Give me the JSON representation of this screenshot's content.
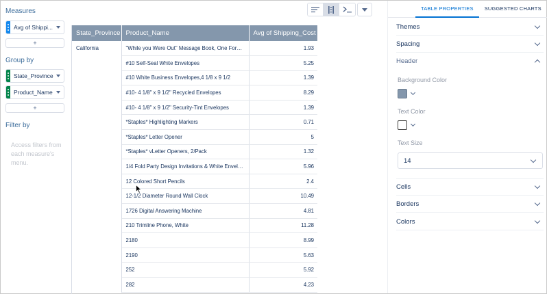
{
  "left_panel": {
    "measures_title": "Measures",
    "measure_pill": "Avg of Shippi...",
    "groupby_title": "Group by",
    "groups": [
      "State_Province",
      "Product_Name"
    ],
    "add_label": "+",
    "filter_title": "Filter by",
    "filter_hint": "Access filters from each measure's menu."
  },
  "toolbar": {
    "icons": [
      "align-lines-icon",
      "column-grid-icon",
      "console-icon"
    ],
    "active_index": 1,
    "dropdown_icon": "chevron-down-icon"
  },
  "table": {
    "headers": [
      "State_Province",
      "Product_Name",
      "Avg of Shipping_Cost"
    ],
    "state": "California",
    "rows": [
      {
        "product": "\"While you Were Out\" Message Book, One Form ...",
        "value": "1.93"
      },
      {
        "product": "#10 Self-Seal White Envelopes",
        "value": "5.25"
      },
      {
        "product": "#10 White Business Envelopes,4 1/8 x 9 1/2",
        "value": "1.39"
      },
      {
        "product": "#10- 4 1/8\" x 9 1/2\" Recycled Envelopes",
        "value": "8.29"
      },
      {
        "product": "#10- 4 1/8\" x 9 1/2\" Security-Tint Envelopes",
        "value": "1.39"
      },
      {
        "product": "*Staples* Highlighting Markers",
        "value": "0.71"
      },
      {
        "product": "*Staples* Letter Opener",
        "value": "5"
      },
      {
        "product": "*Staples* vLetter Openers, 2/Pack",
        "value": "1.32"
      },
      {
        "product": "1/4 Fold Party Design Invitations & White Envelo...",
        "value": "5.96"
      },
      {
        "product": "12 Colored Short Pencils",
        "value": "2.4"
      },
      {
        "product": "12-1/2 Diameter Round Wall Clock",
        "value": "10.49"
      },
      {
        "product": "1726 Digital Answering Machine",
        "value": "4.81"
      },
      {
        "product": "210 Trimline Phone, White",
        "value": "11.28"
      },
      {
        "product": "2180",
        "value": "8.99"
      },
      {
        "product": "2190",
        "value": "5.63"
      },
      {
        "product": "252",
        "value": "5.92"
      },
      {
        "product": "282",
        "value": "4.23"
      }
    ]
  },
  "right_panel": {
    "tabs": [
      "TABLE PROPERTIES",
      "SUGGESTED CHARTS"
    ],
    "active_tab": 0,
    "sections": {
      "themes": "Themes",
      "spacing": "Spacing",
      "header": "Header",
      "cells": "Cells",
      "borders": "Borders",
      "colors": "Colors"
    },
    "background_color_label": "Background Color",
    "background_color_value": "#8497ac",
    "text_color_label": "Text Color",
    "text_color_value": "#ffffff",
    "text_size_label": "Text Size",
    "text_size_value": "14"
  },
  "colors": {
    "accent": "#0070d2",
    "header_bg": "#8497ac",
    "measure_pill": "#1589ee",
    "group_pill": "#04844b"
  }
}
